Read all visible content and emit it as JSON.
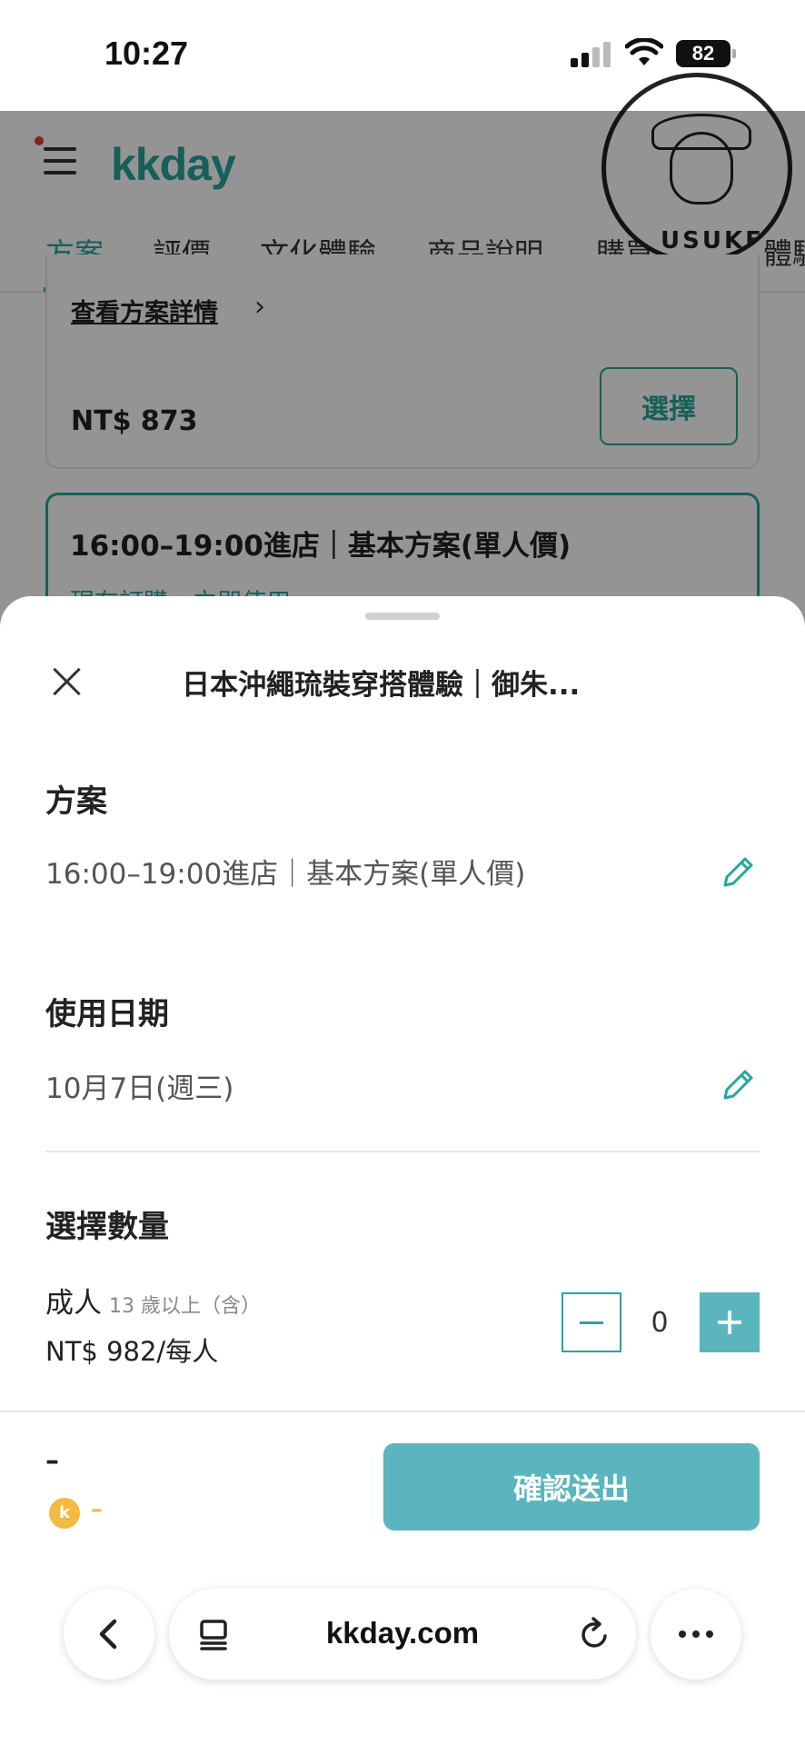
{
  "status_bar": {
    "time": "10:27",
    "battery": "82"
  },
  "header": {
    "logo": "kkday",
    "tabs": [
      "方案",
      "評價",
      "文化體驗",
      "商品說明",
      "購買須知",
      "體驗"
    ]
  },
  "stamp": {
    "text": "USUKE"
  },
  "background": {
    "detail_link": "查看方案詳情",
    "price": "NT$ 873",
    "select_label": "選擇",
    "card2_title": "16:00–19:00進店｜基本方案(單人價)",
    "card2_sub": "現在訂購・立即使用"
  },
  "sheet": {
    "title": "日本沖繩琉裝穿搭體驗｜御朱...",
    "plan_label": "方案",
    "plan_value": "16:00–19:00進店｜基本方案(單人價)",
    "date_label": "使用日期",
    "date_value": "10月7日(週三)",
    "quantity_label": "選擇數量",
    "adult_label": "成人",
    "adult_age": "13 歲以上（含）",
    "adult_price": "NT$ 982/每人",
    "quantity": "0",
    "total": "–",
    "coin_label": "k",
    "points": "–",
    "confirm_label": "確認送出"
  },
  "browser": {
    "url": "kkday.com"
  }
}
